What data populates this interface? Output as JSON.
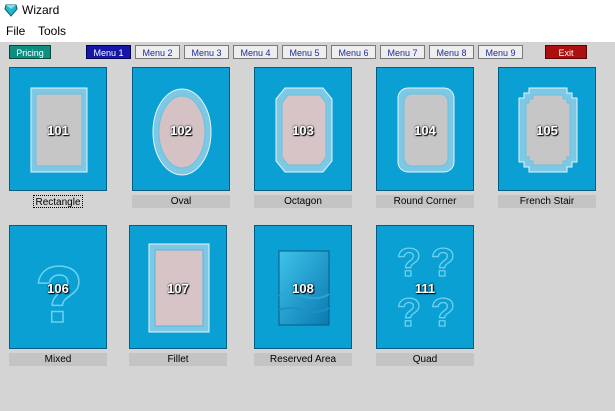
{
  "window": {
    "title": "Wizard",
    "icon": "app-gem-icon"
  },
  "menubar": {
    "items": [
      {
        "label": "File"
      },
      {
        "label": "Tools"
      }
    ]
  },
  "toolbar": {
    "pricing_label": "Pricing",
    "menus": [
      "Menu 1",
      "Menu 2",
      "Menu 3",
      "Menu 4",
      "Menu 5",
      "Menu 6",
      "Menu 7",
      "Menu 8",
      "Menu 9"
    ],
    "active_menu": "Menu 1",
    "exit_label": "Exit"
  },
  "tiles": [
    {
      "number": "101",
      "label": "Rectangle",
      "icon": "rectangle-frame-icon"
    },
    {
      "number": "102",
      "label": "Oval",
      "icon": "oval-frame-icon"
    },
    {
      "number": "103",
      "label": "Octagon",
      "icon": "octagon-frame-icon"
    },
    {
      "number": "104",
      "label": "Round Corner",
      "icon": "round-corner-frame-icon"
    },
    {
      "number": "105",
      "label": "French Stair",
      "icon": "french-stair-frame-icon"
    },
    {
      "number": "106",
      "label": "Mixed",
      "icon": "question-mark-icon"
    },
    {
      "number": "107",
      "label": "Fillet",
      "icon": "fillet-frame-icon"
    },
    {
      "number": "108",
      "label": "Reserved Area",
      "icon": "reserved-area-icon"
    },
    {
      "number": "111",
      "label": "Quad",
      "icon": "quad-question-icon"
    }
  ],
  "colors": {
    "tile_blue": "#0aa0d4",
    "active_menu": "#1616a8",
    "pricing": "#0f8e7f",
    "exit": "#ad0f0f",
    "background": "#d4d4d4"
  }
}
